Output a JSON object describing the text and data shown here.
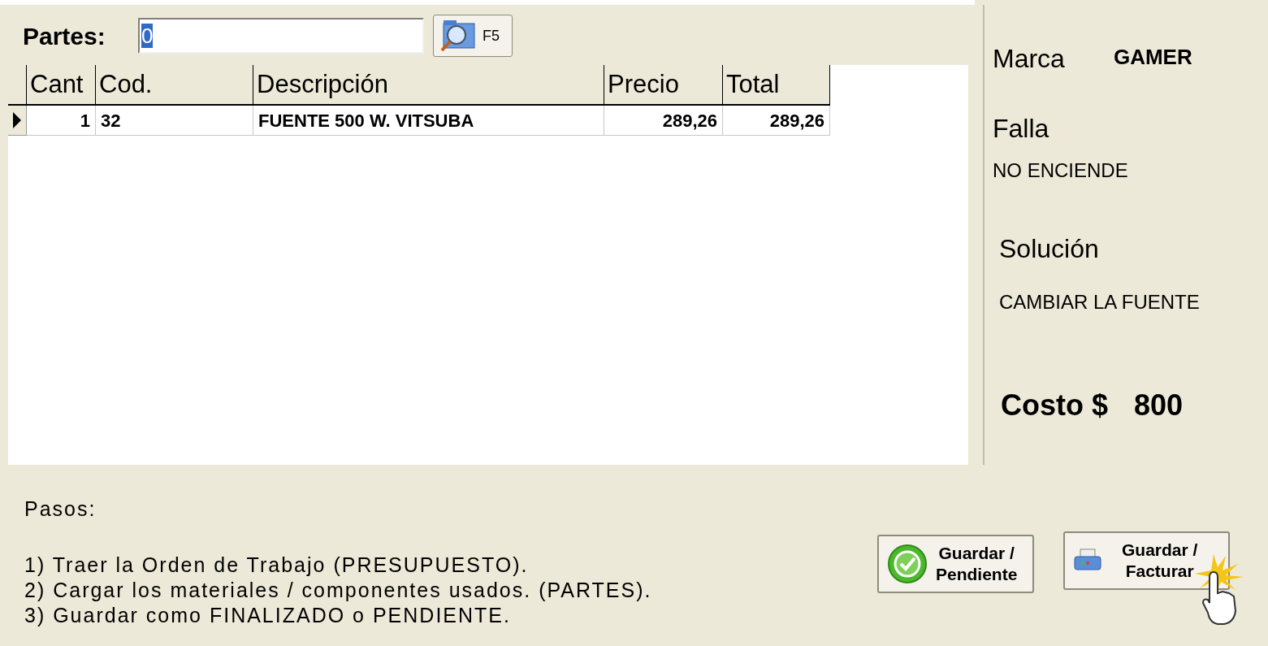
{
  "parts_field": {
    "label": "Partes:",
    "value": "0",
    "search_key": "F5"
  },
  "table": {
    "columns": [
      "Cant",
      "Cod.",
      "Descripción",
      "Precio",
      "Total"
    ],
    "rows": [
      {
        "selected": true,
        "cells": [
          "1",
          "32",
          "FUENTE 500 W. VITSUBA",
          "289,26",
          "289,26"
        ]
      }
    ]
  },
  "details": {
    "brand_label": "Marca",
    "brand": "GAMER",
    "fault_label": "Falla",
    "fault": "NO ENCIENDE",
    "solution_label": "Solución",
    "solution": "CAMBIAR LA FUENTE",
    "cost_label": "Costo $",
    "cost": "800"
  },
  "steps": {
    "title": "Pasos:",
    "items": [
      "1) Traer la Orden de Trabajo (PRESUPUESTO).",
      "2) Cargar los materiales / componentes usados. (PARTES).",
      "3) Guardar como FINALIZADO o PENDIENTE."
    ]
  },
  "buttons": [
    {
      "kind": "pending",
      "lines": [
        "Guardar /",
        "Pendiente"
      ]
    },
    {
      "kind": "invoice",
      "lines": [
        "Guardar /",
        "Facturar"
      ]
    }
  ]
}
